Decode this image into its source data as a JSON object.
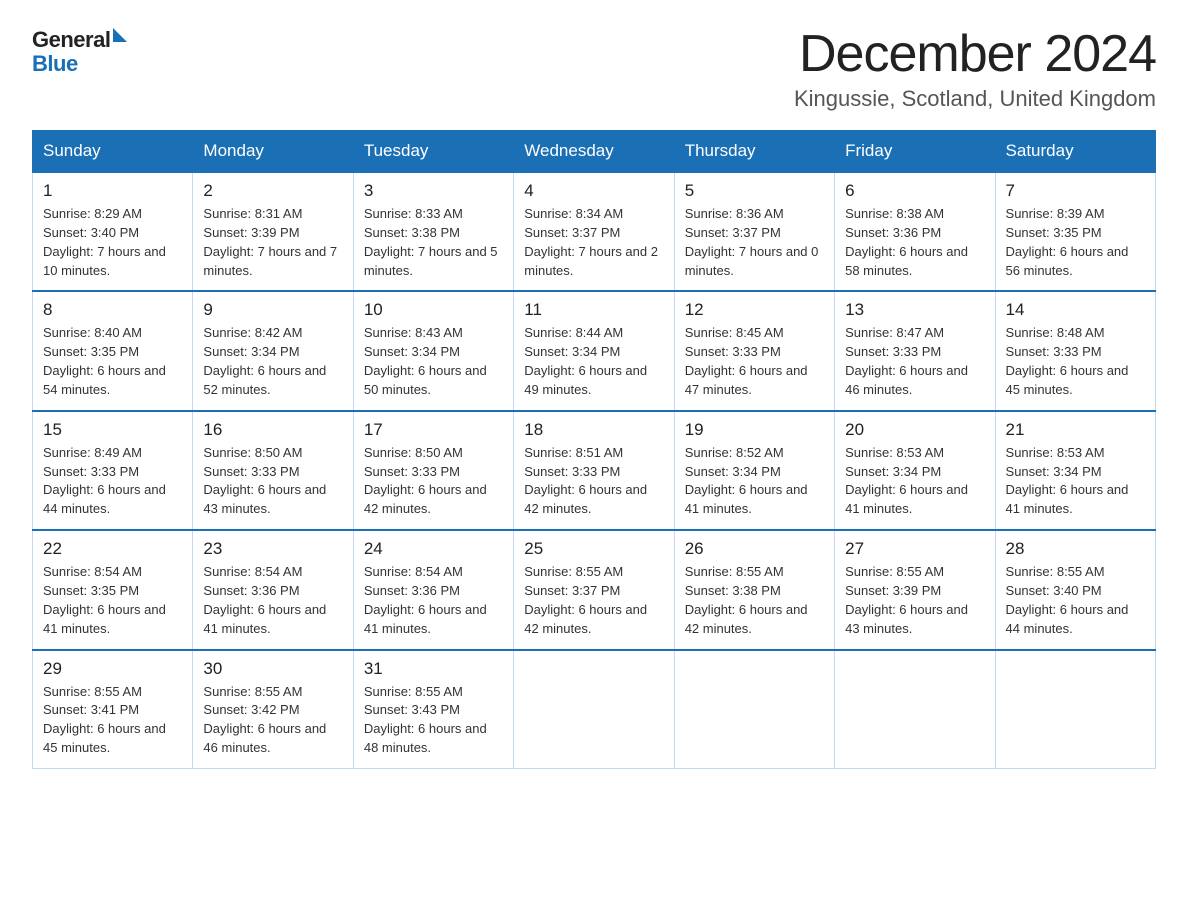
{
  "header": {
    "logo_general": "General",
    "logo_blue": "Blue",
    "title": "December 2024",
    "subtitle": "Kingussie, Scotland, United Kingdom"
  },
  "days_of_week": [
    "Sunday",
    "Monday",
    "Tuesday",
    "Wednesday",
    "Thursday",
    "Friday",
    "Saturday"
  ],
  "weeks": [
    [
      {
        "day": "1",
        "sunrise": "8:29 AM",
        "sunset": "3:40 PM",
        "daylight": "7 hours and 10 minutes."
      },
      {
        "day": "2",
        "sunrise": "8:31 AM",
        "sunset": "3:39 PM",
        "daylight": "7 hours and 7 minutes."
      },
      {
        "day": "3",
        "sunrise": "8:33 AM",
        "sunset": "3:38 PM",
        "daylight": "7 hours and 5 minutes."
      },
      {
        "day": "4",
        "sunrise": "8:34 AM",
        "sunset": "3:37 PM",
        "daylight": "7 hours and 2 minutes."
      },
      {
        "day": "5",
        "sunrise": "8:36 AM",
        "sunset": "3:37 PM",
        "daylight": "7 hours and 0 minutes."
      },
      {
        "day": "6",
        "sunrise": "8:38 AM",
        "sunset": "3:36 PM",
        "daylight": "6 hours and 58 minutes."
      },
      {
        "day": "7",
        "sunrise": "8:39 AM",
        "sunset": "3:35 PM",
        "daylight": "6 hours and 56 minutes."
      }
    ],
    [
      {
        "day": "8",
        "sunrise": "8:40 AM",
        "sunset": "3:35 PM",
        "daylight": "6 hours and 54 minutes."
      },
      {
        "day": "9",
        "sunrise": "8:42 AM",
        "sunset": "3:34 PM",
        "daylight": "6 hours and 52 minutes."
      },
      {
        "day": "10",
        "sunrise": "8:43 AM",
        "sunset": "3:34 PM",
        "daylight": "6 hours and 50 minutes."
      },
      {
        "day": "11",
        "sunrise": "8:44 AM",
        "sunset": "3:34 PM",
        "daylight": "6 hours and 49 minutes."
      },
      {
        "day": "12",
        "sunrise": "8:45 AM",
        "sunset": "3:33 PM",
        "daylight": "6 hours and 47 minutes."
      },
      {
        "day": "13",
        "sunrise": "8:47 AM",
        "sunset": "3:33 PM",
        "daylight": "6 hours and 46 minutes."
      },
      {
        "day": "14",
        "sunrise": "8:48 AM",
        "sunset": "3:33 PM",
        "daylight": "6 hours and 45 minutes."
      }
    ],
    [
      {
        "day": "15",
        "sunrise": "8:49 AM",
        "sunset": "3:33 PM",
        "daylight": "6 hours and 44 minutes."
      },
      {
        "day": "16",
        "sunrise": "8:50 AM",
        "sunset": "3:33 PM",
        "daylight": "6 hours and 43 minutes."
      },
      {
        "day": "17",
        "sunrise": "8:50 AM",
        "sunset": "3:33 PM",
        "daylight": "6 hours and 42 minutes."
      },
      {
        "day": "18",
        "sunrise": "8:51 AM",
        "sunset": "3:33 PM",
        "daylight": "6 hours and 42 minutes."
      },
      {
        "day": "19",
        "sunrise": "8:52 AM",
        "sunset": "3:34 PM",
        "daylight": "6 hours and 41 minutes."
      },
      {
        "day": "20",
        "sunrise": "8:53 AM",
        "sunset": "3:34 PM",
        "daylight": "6 hours and 41 minutes."
      },
      {
        "day": "21",
        "sunrise": "8:53 AM",
        "sunset": "3:34 PM",
        "daylight": "6 hours and 41 minutes."
      }
    ],
    [
      {
        "day": "22",
        "sunrise": "8:54 AM",
        "sunset": "3:35 PM",
        "daylight": "6 hours and 41 minutes."
      },
      {
        "day": "23",
        "sunrise": "8:54 AM",
        "sunset": "3:36 PM",
        "daylight": "6 hours and 41 minutes."
      },
      {
        "day": "24",
        "sunrise": "8:54 AM",
        "sunset": "3:36 PM",
        "daylight": "6 hours and 41 minutes."
      },
      {
        "day": "25",
        "sunrise": "8:55 AM",
        "sunset": "3:37 PM",
        "daylight": "6 hours and 42 minutes."
      },
      {
        "day": "26",
        "sunrise": "8:55 AM",
        "sunset": "3:38 PM",
        "daylight": "6 hours and 42 minutes."
      },
      {
        "day": "27",
        "sunrise": "8:55 AM",
        "sunset": "3:39 PM",
        "daylight": "6 hours and 43 minutes."
      },
      {
        "day": "28",
        "sunrise": "8:55 AM",
        "sunset": "3:40 PM",
        "daylight": "6 hours and 44 minutes."
      }
    ],
    [
      {
        "day": "29",
        "sunrise": "8:55 AM",
        "sunset": "3:41 PM",
        "daylight": "6 hours and 45 minutes."
      },
      {
        "day": "30",
        "sunrise": "8:55 AM",
        "sunset": "3:42 PM",
        "daylight": "6 hours and 46 minutes."
      },
      {
        "day": "31",
        "sunrise": "8:55 AM",
        "sunset": "3:43 PM",
        "daylight": "6 hours and 48 minutes."
      },
      null,
      null,
      null,
      null
    ]
  ]
}
